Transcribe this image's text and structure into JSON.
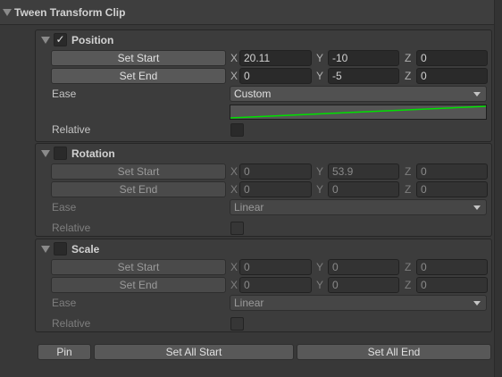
{
  "header": {
    "title": "Tween Transform Clip"
  },
  "sections": [
    {
      "title": "Position",
      "enabled": true,
      "set_start": "Set Start",
      "set_end": "Set End",
      "start": {
        "x": "20.11",
        "y": "-10",
        "z": "0"
      },
      "end": {
        "x": "0",
        "y": "-5",
        "z": "0"
      },
      "ease_label": "Ease",
      "ease": "Custom",
      "relative_label": "Relative",
      "relative": false
    },
    {
      "title": "Rotation",
      "enabled": false,
      "set_start": "Set Start",
      "set_end": "Set End",
      "start": {
        "x": "0",
        "y": "53.9",
        "z": "0"
      },
      "end": {
        "x": "0",
        "y": "0",
        "z": "0"
      },
      "ease_label": "Ease",
      "ease": "Linear",
      "relative_label": "Relative",
      "relative": false
    },
    {
      "title": "Scale",
      "enabled": false,
      "set_start": "Set Start",
      "set_end": "Set End",
      "start": {
        "x": "0",
        "y": "0",
        "z": "0"
      },
      "end": {
        "x": "0",
        "y": "0",
        "z": "0"
      },
      "ease_label": "Ease",
      "ease": "Linear",
      "relative_label": "Relative",
      "relative": false
    }
  ],
  "axes": {
    "x": "X",
    "y": "Y",
    "z": "Z"
  },
  "footer": {
    "pin": "Pin",
    "set_all_start": "Set All Start",
    "set_all_end": "Set All End"
  },
  "colors": {
    "curve": "#00e000",
    "checkmark": "✓"
  }
}
